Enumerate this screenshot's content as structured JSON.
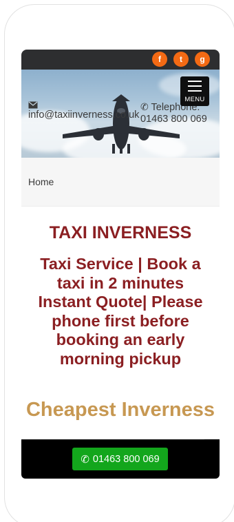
{
  "header": {
    "social_facebook": "f",
    "social_twitter": "t",
    "social_google": "g",
    "menu_label": "MENU"
  },
  "hero": {
    "email_label": "info@taxiinverness.co.uk",
    "phone_title": "Telephone:",
    "phone_number": "01463 800 069"
  },
  "breadcrumb": {
    "home": "Home"
  },
  "main": {
    "title": "TAXI INVERNESS",
    "subtitle": "Taxi Service | Book a taxi in 2 minutes Instant Quote| Please phone first before booking an early morning pickup",
    "tagline": "Cheapest Inverness"
  },
  "footer": {
    "call_label": "01463 800 069"
  },
  "colors": {
    "accent_red": "#8b1f22",
    "accent_gold": "#c79852",
    "call_green": "#13a61c",
    "social_orange": "#f46a14"
  },
  "icons": [
    "envelope-icon",
    "phone-icon",
    "facebook-icon",
    "twitter-icon",
    "google-icon",
    "hamburger-icon"
  ]
}
